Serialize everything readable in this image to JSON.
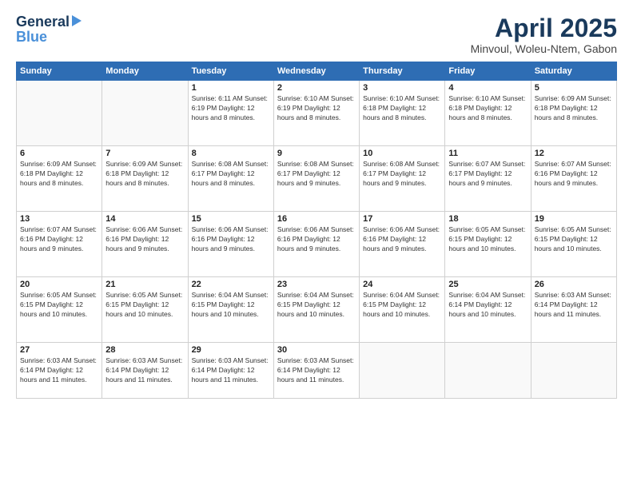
{
  "header": {
    "logo_general": "General",
    "logo_blue": "Blue",
    "title": "April 2025",
    "subtitle": "Minvoul, Woleu-Ntem, Gabon"
  },
  "days_of_week": [
    "Sunday",
    "Monday",
    "Tuesday",
    "Wednesday",
    "Thursday",
    "Friday",
    "Saturday"
  ],
  "weeks": [
    [
      {
        "day": "",
        "detail": ""
      },
      {
        "day": "",
        "detail": ""
      },
      {
        "day": "1",
        "detail": "Sunrise: 6:11 AM\nSunset: 6:19 PM\nDaylight: 12 hours and 8 minutes."
      },
      {
        "day": "2",
        "detail": "Sunrise: 6:10 AM\nSunset: 6:19 PM\nDaylight: 12 hours and 8 minutes."
      },
      {
        "day": "3",
        "detail": "Sunrise: 6:10 AM\nSunset: 6:18 PM\nDaylight: 12 hours and 8 minutes."
      },
      {
        "day": "4",
        "detail": "Sunrise: 6:10 AM\nSunset: 6:18 PM\nDaylight: 12 hours and 8 minutes."
      },
      {
        "day": "5",
        "detail": "Sunrise: 6:09 AM\nSunset: 6:18 PM\nDaylight: 12 hours and 8 minutes."
      }
    ],
    [
      {
        "day": "6",
        "detail": "Sunrise: 6:09 AM\nSunset: 6:18 PM\nDaylight: 12 hours and 8 minutes."
      },
      {
        "day": "7",
        "detail": "Sunrise: 6:09 AM\nSunset: 6:18 PM\nDaylight: 12 hours and 8 minutes."
      },
      {
        "day": "8",
        "detail": "Sunrise: 6:08 AM\nSunset: 6:17 PM\nDaylight: 12 hours and 8 minutes."
      },
      {
        "day": "9",
        "detail": "Sunrise: 6:08 AM\nSunset: 6:17 PM\nDaylight: 12 hours and 9 minutes."
      },
      {
        "day": "10",
        "detail": "Sunrise: 6:08 AM\nSunset: 6:17 PM\nDaylight: 12 hours and 9 minutes."
      },
      {
        "day": "11",
        "detail": "Sunrise: 6:07 AM\nSunset: 6:17 PM\nDaylight: 12 hours and 9 minutes."
      },
      {
        "day": "12",
        "detail": "Sunrise: 6:07 AM\nSunset: 6:16 PM\nDaylight: 12 hours and 9 minutes."
      }
    ],
    [
      {
        "day": "13",
        "detail": "Sunrise: 6:07 AM\nSunset: 6:16 PM\nDaylight: 12 hours and 9 minutes."
      },
      {
        "day": "14",
        "detail": "Sunrise: 6:06 AM\nSunset: 6:16 PM\nDaylight: 12 hours and 9 minutes."
      },
      {
        "day": "15",
        "detail": "Sunrise: 6:06 AM\nSunset: 6:16 PM\nDaylight: 12 hours and 9 minutes."
      },
      {
        "day": "16",
        "detail": "Sunrise: 6:06 AM\nSunset: 6:16 PM\nDaylight: 12 hours and 9 minutes."
      },
      {
        "day": "17",
        "detail": "Sunrise: 6:06 AM\nSunset: 6:16 PM\nDaylight: 12 hours and 9 minutes."
      },
      {
        "day": "18",
        "detail": "Sunrise: 6:05 AM\nSunset: 6:15 PM\nDaylight: 12 hours and 10 minutes."
      },
      {
        "day": "19",
        "detail": "Sunrise: 6:05 AM\nSunset: 6:15 PM\nDaylight: 12 hours and 10 minutes."
      }
    ],
    [
      {
        "day": "20",
        "detail": "Sunrise: 6:05 AM\nSunset: 6:15 PM\nDaylight: 12 hours and 10 minutes."
      },
      {
        "day": "21",
        "detail": "Sunrise: 6:05 AM\nSunset: 6:15 PM\nDaylight: 12 hours and 10 minutes."
      },
      {
        "day": "22",
        "detail": "Sunrise: 6:04 AM\nSunset: 6:15 PM\nDaylight: 12 hours and 10 minutes."
      },
      {
        "day": "23",
        "detail": "Sunrise: 6:04 AM\nSunset: 6:15 PM\nDaylight: 12 hours and 10 minutes."
      },
      {
        "day": "24",
        "detail": "Sunrise: 6:04 AM\nSunset: 6:15 PM\nDaylight: 12 hours and 10 minutes."
      },
      {
        "day": "25",
        "detail": "Sunrise: 6:04 AM\nSunset: 6:14 PM\nDaylight: 12 hours and 10 minutes."
      },
      {
        "day": "26",
        "detail": "Sunrise: 6:03 AM\nSunset: 6:14 PM\nDaylight: 12 hours and 11 minutes."
      }
    ],
    [
      {
        "day": "27",
        "detail": "Sunrise: 6:03 AM\nSunset: 6:14 PM\nDaylight: 12 hours and 11 minutes."
      },
      {
        "day": "28",
        "detail": "Sunrise: 6:03 AM\nSunset: 6:14 PM\nDaylight: 12 hours and 11 minutes."
      },
      {
        "day": "29",
        "detail": "Sunrise: 6:03 AM\nSunset: 6:14 PM\nDaylight: 12 hours and 11 minutes."
      },
      {
        "day": "30",
        "detail": "Sunrise: 6:03 AM\nSunset: 6:14 PM\nDaylight: 12 hours and 11 minutes."
      },
      {
        "day": "",
        "detail": ""
      },
      {
        "day": "",
        "detail": ""
      },
      {
        "day": "",
        "detail": ""
      }
    ]
  ]
}
